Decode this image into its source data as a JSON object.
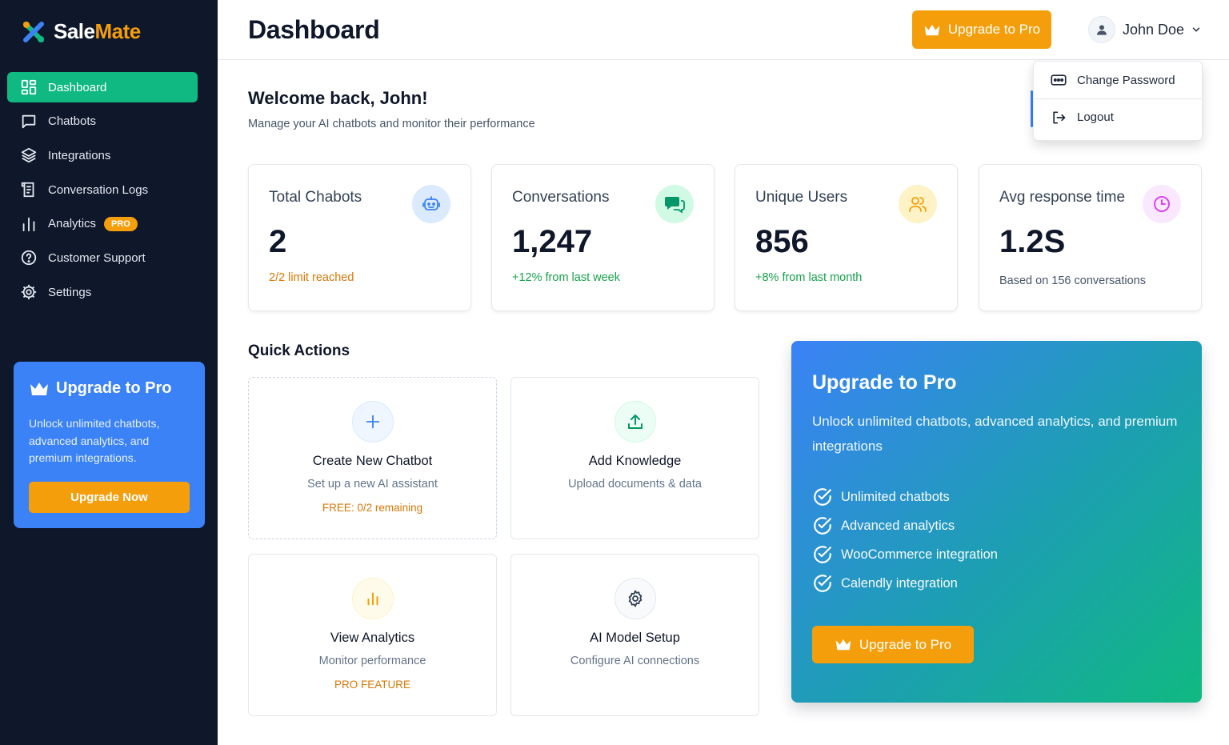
{
  "app": {
    "logo_part1": "Sale",
    "logo_part2": "Mate"
  },
  "sidebar": {
    "items": [
      {
        "label": "Dashboard",
        "icon": "dashboard-grid-icon",
        "active": true
      },
      {
        "label": "Chatbots",
        "icon": "chat-bubble-icon"
      },
      {
        "label": "Integrations",
        "icon": "layers-icon"
      },
      {
        "label": "Conversation Logs",
        "icon": "document-log-icon"
      },
      {
        "label": "Analytics",
        "icon": "bar-chart-icon",
        "badge": "PRO"
      },
      {
        "label": "Customer Support",
        "icon": "help-circle-icon"
      },
      {
        "label": "Settings",
        "icon": "gear-icon"
      }
    ],
    "upgrade": {
      "title": "Upgrade to Pro",
      "description": "Unlock unlimited chatbots, advanced analytics, and premium integrations.",
      "button": "Upgrade Now"
    }
  },
  "header": {
    "title": "Dashboard",
    "upgrade_button": "Upgrade to Pro",
    "user_name": "John Doe"
  },
  "user_menu": {
    "items": [
      {
        "label": "Change Password",
        "icon": "password-icon"
      },
      {
        "label": "Logout",
        "icon": "logout-icon"
      }
    ]
  },
  "welcome": {
    "title": "Welcome back, John!",
    "subtitle": "Manage your AI chatbots and monitor their performance"
  },
  "stats": [
    {
      "label": "Total Chabots",
      "value": "2",
      "note": "2/2 limit reached",
      "note_color": "#d97706",
      "icon": "robot-icon",
      "icon_bg": "#dbeafe",
      "icon_color": "#3b82f6"
    },
    {
      "label": "Conversations",
      "value": "1,247",
      "note": "+12% from last week",
      "note_color": "#16a34a",
      "icon": "chat-bubbles-icon",
      "icon_bg": "#d1fae5",
      "icon_color": "#059669"
    },
    {
      "label": "Unique Users",
      "value": "856",
      "note": "+8% from last month",
      "note_color": "#16a34a",
      "icon": "users-icon",
      "icon_bg": "#fef3c7",
      "icon_color": "#f59e0b"
    },
    {
      "label": "Avg response time",
      "value": "1.2S",
      "note": "Based on 156 conversations",
      "note_color": "#475569",
      "icon": "clock-icon",
      "icon_bg": "#fae8ff",
      "icon_color": "#d946ef"
    }
  ],
  "quick_actions": {
    "title": "Quick Actions",
    "cards": [
      {
        "name": "Create New Chatbot",
        "description": "Set up a new AI assistant",
        "tag": "FREE: 0/2 remaining",
        "icon": "plus-icon"
      },
      {
        "name": "Add Knowledge",
        "description": "Upload documents & data",
        "icon": "upload-icon"
      },
      {
        "name": "View Analytics",
        "description": "Monitor performance",
        "tag": "PRO FEATURE",
        "icon": "bar-chart-icon"
      },
      {
        "name": "AI Model Setup",
        "description": "Configure AI connections",
        "icon": "gear-icon"
      }
    ]
  },
  "pro_panel": {
    "title": "Upgrade to Pro",
    "description": "Unlock unlimited chatbots, advanced analytics, and premium  integrations",
    "features": [
      "Unlimited chatbots",
      "Advanced analytics",
      "WooCommerce integration",
      "Calendly integration"
    ],
    "button": "Upgrade to Pro"
  },
  "colors": {
    "sidebar_bg": "#0f172a",
    "accent_green": "#10b981",
    "accent_orange": "#f59e0b",
    "accent_blue": "#3b82f6"
  }
}
